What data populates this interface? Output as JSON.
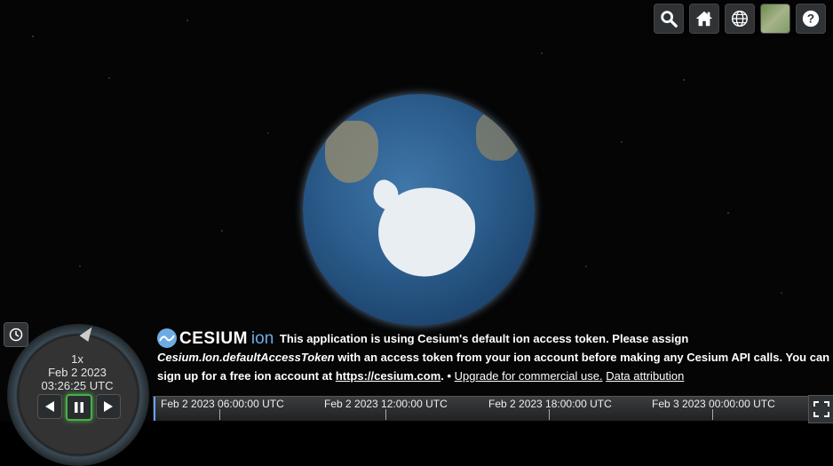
{
  "toolbar": {
    "buttons": [
      {
        "name": "search",
        "icon": "search-icon"
      },
      {
        "name": "home",
        "icon": "home-icon"
      },
      {
        "name": "scene-mode",
        "icon": "globe-icon"
      },
      {
        "name": "base-layer-picker",
        "icon": "imagery-thumbnail"
      },
      {
        "name": "help",
        "icon": "help-icon"
      }
    ]
  },
  "animation": {
    "speed": "1x",
    "date": "Feb 2 2023",
    "time": "03:26:25 UTC"
  },
  "credits": {
    "logo_text": "CESIUM",
    "logo_ion": "ion",
    "message_1": "This application is using Cesium's default ion access token. Please assign ",
    "message_code": "Cesium.Ion.defaultAccessToken",
    "message_2": " with an access token from your ion account before making any Cesium API calls. You can sign up for a free ion account at ",
    "link_url_text": "https://cesium.com",
    "message_3": ". • ",
    "upgrade_link": "Upgrade for commercial use.",
    "data_attribution": "Data attribution"
  },
  "timeline": {
    "ticks": [
      "Feb 2 2023 06:00:00 UTC",
      "Feb 2 2023 12:00:00 UTC",
      "Feb 2 2023 18:00:00 UTC",
      "Feb 3 2023 00:00:00 UTC"
    ]
  },
  "colors": {
    "accent": "#6dabe4",
    "active_play": "#48b048"
  }
}
